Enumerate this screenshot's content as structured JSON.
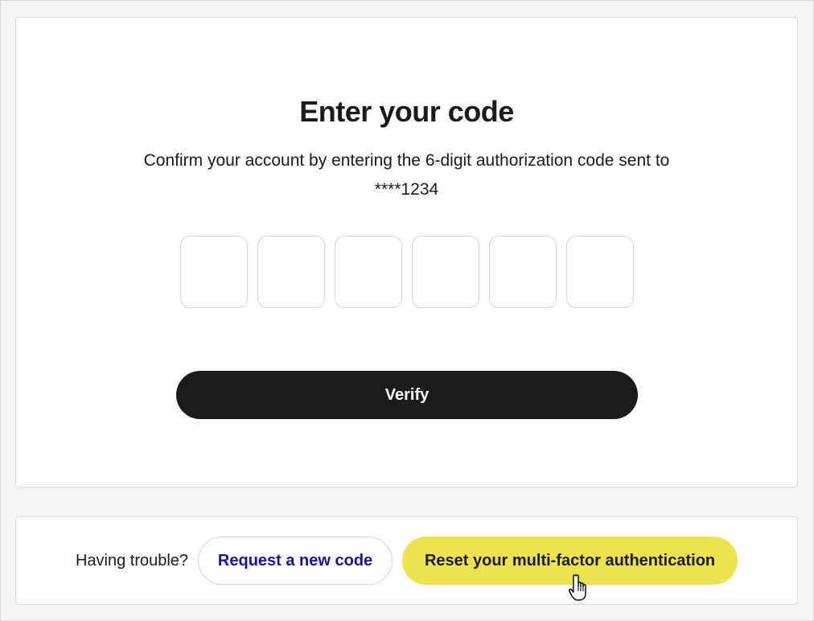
{
  "verify": {
    "title": "Enter your code",
    "description": "Confirm your account by entering the 6-digit authorization code sent to ****1234",
    "code_fields": [
      "",
      "",
      "",
      "",
      "",
      ""
    ],
    "verify_label": "Verify"
  },
  "help": {
    "prompt": "Having trouble?",
    "request_code_label": "Request a new code",
    "reset_mfa_label": "Reset your multi-factor authentication"
  },
  "colors": {
    "primary_button": "#1b1b1b",
    "link_text": "#1212a8",
    "highlight_button": "#ece34f"
  },
  "icons": {
    "cursor": "hand-pointer-icon"
  }
}
